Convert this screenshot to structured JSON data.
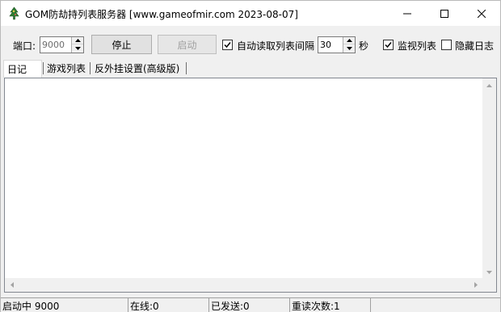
{
  "window": {
    "title": "GOM防劫持列表服务器 [www.gameofmir.com 2023-08-07]",
    "icon": "app-tree-icon",
    "controls": [
      "minimize-icon",
      "maximize-icon",
      "close-icon"
    ]
  },
  "toolbar": {
    "port_label": "端口:",
    "port_value": "9000",
    "stop_button": "停止",
    "start_button": "启动",
    "auto_read_label": "自动读取列表间隔",
    "auto_read_checked": true,
    "interval_value": "30",
    "seconds_label": "秒",
    "monitor_label": "监视列表",
    "monitor_checked": true,
    "hide_log_label": "隐藏日志",
    "hide_log_checked": false
  },
  "tabs": [
    {
      "label": "日记",
      "active": true
    },
    {
      "label": "游戏列表",
      "active": false
    },
    {
      "label": "反外挂设置(高级版)",
      "active": false
    }
  ],
  "log": {
    "lines": []
  },
  "status": {
    "state": "启动中 9000",
    "online": "在线:0",
    "sent": "已发送:0",
    "reread": "重读次数:1"
  }
}
